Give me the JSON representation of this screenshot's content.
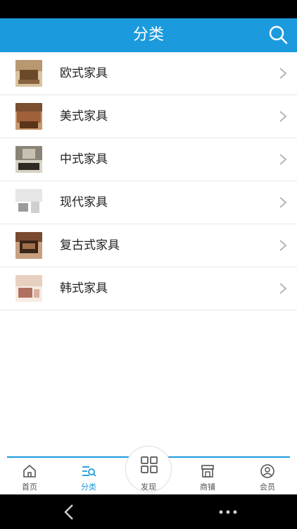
{
  "header": {
    "title": "分类"
  },
  "categories": [
    {
      "label": "欧式家具",
      "thumb_colors": [
        "#b89870",
        "#6a4a2a",
        "#d9c3a0"
      ]
    },
    {
      "label": "美式家具",
      "thumb_colors": [
        "#a0603a",
        "#5a3418",
        "#c89a70"
      ]
    },
    {
      "label": "中式家具",
      "thumb_colors": [
        "#8a8478",
        "#2e2a24",
        "#d8d2c6"
      ]
    },
    {
      "label": "现代家具",
      "thumb_colors": [
        "#e6e6e6",
        "#9a9a9a",
        "#ffffff"
      ]
    },
    {
      "label": "复古式家具",
      "thumb_colors": [
        "#7a4a30",
        "#3a2418",
        "#c8a080"
      ]
    },
    {
      "label": "韩式家具",
      "thumb_colors": [
        "#e8d0c0",
        "#b07060",
        "#f6ece4"
      ]
    }
  ],
  "tabbar": {
    "home": "首页",
    "category": "分类",
    "discover": "发现",
    "shop": "商铺",
    "member": "会员"
  },
  "colors": {
    "accent": "#1b9bdd",
    "text": "#222222"
  },
  "icons": [
    "search-icon",
    "chevron-right-icon",
    "home-icon",
    "category-icon",
    "grid-icon",
    "store-icon",
    "user-icon",
    "back-icon",
    "more-icon"
  ]
}
